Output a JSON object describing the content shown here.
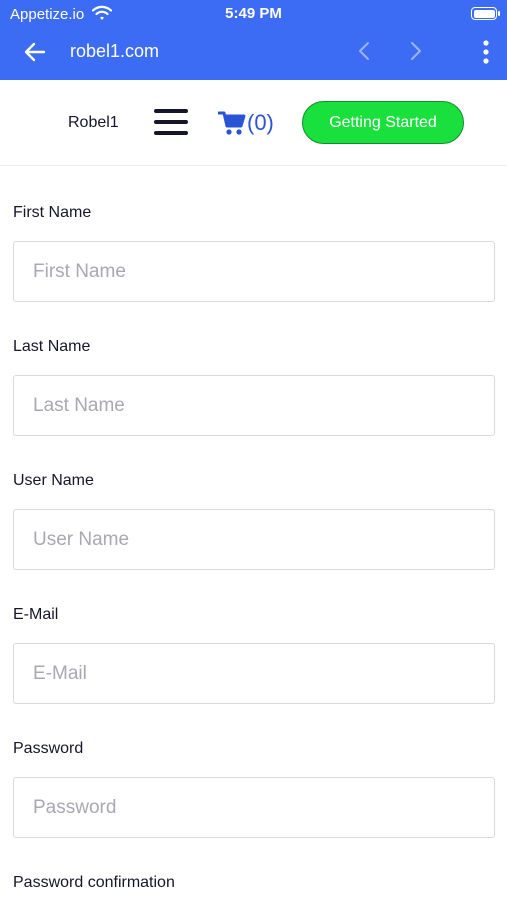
{
  "status_bar": {
    "carrier": "Appetize.io",
    "time": "5:49 PM"
  },
  "browser": {
    "url": "robel1.com"
  },
  "header": {
    "brand": "Robel1",
    "cart_count": "(0)",
    "cta_label": "Getting Started"
  },
  "form": {
    "fields": [
      {
        "label": "First Name",
        "placeholder": "First Name",
        "value": ""
      },
      {
        "label": "Last Name",
        "placeholder": "Last Name",
        "value": ""
      },
      {
        "label": "User Name",
        "placeholder": "User Name",
        "value": ""
      },
      {
        "label": "E-Mail",
        "placeholder": "E-Mail",
        "value": ""
      },
      {
        "label": "Password",
        "placeholder": "Password",
        "value": ""
      },
      {
        "label": "Password confirmation"
      }
    ]
  },
  "colors": {
    "browser_bar": "#3d6cf4",
    "cart_blue": "#2a54d6",
    "cta_green": "#19e03c",
    "text_dark": "#16162a",
    "placeholder": "#a8a8b3",
    "input_border": "#d9d9df"
  },
  "icons": [
    "wifi-icon",
    "battery-icon",
    "back-arrow-icon",
    "chevron-left-icon",
    "chevron-right-icon",
    "more-vertical-icon",
    "menu-icon",
    "cart-icon"
  ]
}
